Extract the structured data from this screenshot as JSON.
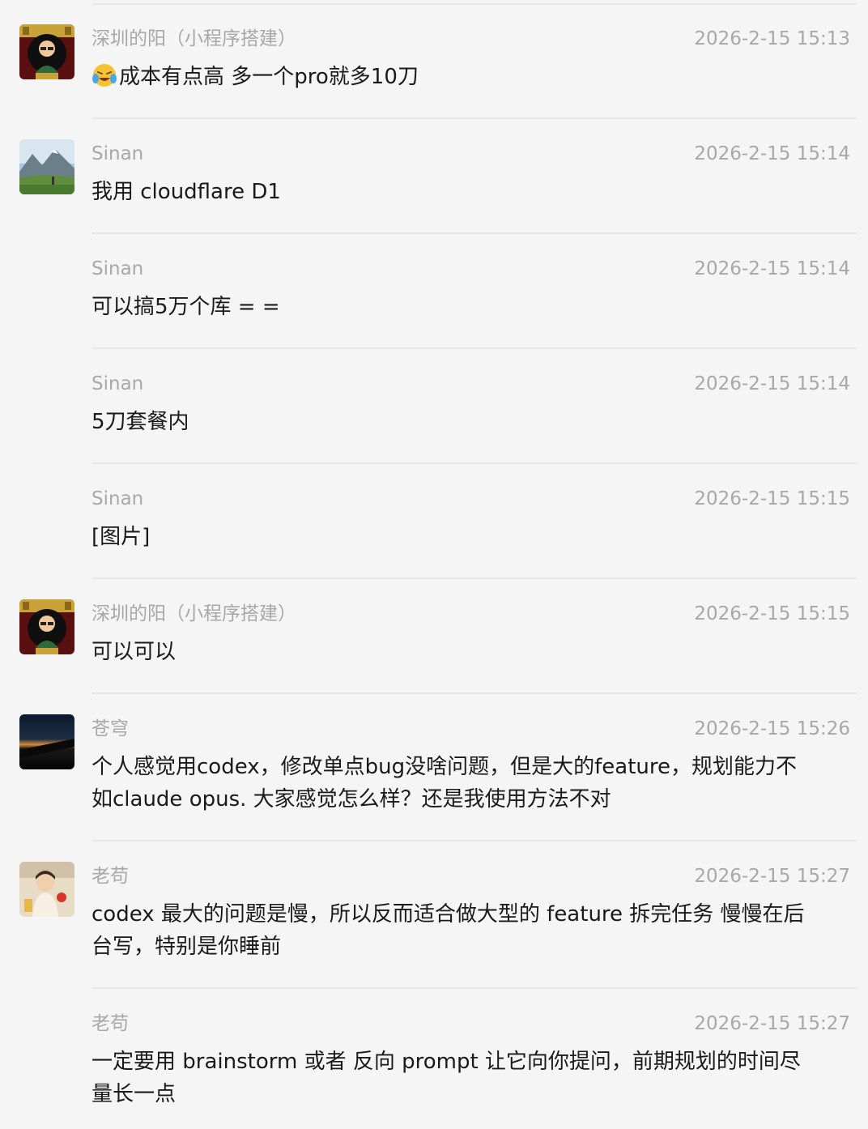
{
  "messages": [
    {
      "sender": "深圳的阳（小程序搭建）",
      "time": "2026-2-15 15:13",
      "text": "成本有点高 多一个pro就多10刀",
      "emoji": "laughing-crying-emoji"
    },
    {
      "sender": "Sinan",
      "time": "2026-2-15 15:14",
      "text": "我用 cloudflare D1"
    },
    {
      "sender": "Sinan",
      "time": "2026-2-15 15:14",
      "text": "可以搞5万个库 = ="
    },
    {
      "sender": "Sinan",
      "time": "2026-2-15 15:14",
      "text": "5刀套餐内"
    },
    {
      "sender": "Sinan",
      "time": "2026-2-15 15:15",
      "text": "[图片]"
    },
    {
      "sender": "深圳的阳（小程序搭建）",
      "time": "2026-2-15 15:15",
      "text": "可以可以"
    },
    {
      "sender": "苍穹",
      "time": "2026-2-15 15:26",
      "line1": "个人感觉用codex，修改单点bug没啥问题，但是大的feature，规划能力不",
      "line2": "如claude opus. 大家感觉怎么样？还是我使用方法不对"
    },
    {
      "sender": "老苟",
      "time": "2026-2-15 15:27",
      "line1": "codex 最大的问题是慢，所以反而适合做大型的 feature 拆完任务 慢慢在后",
      "line2": "台写，特别是你睡前"
    },
    {
      "sender": "老苟",
      "time": "2026-2-15 15:27",
      "line1": "一定要用 brainstorm 或者 反向 prompt 让它向你提问，前期规划的时间尽",
      "line2": "量长一点"
    }
  ]
}
